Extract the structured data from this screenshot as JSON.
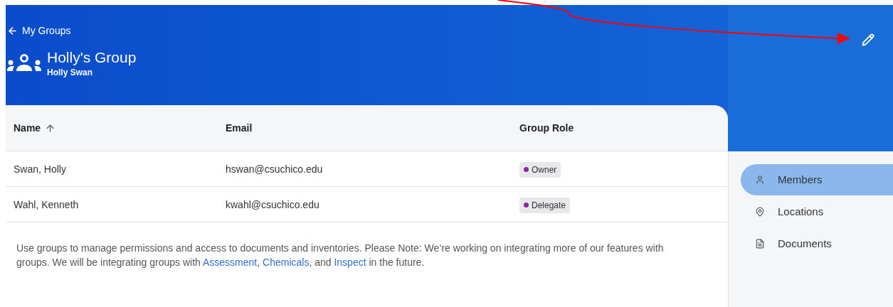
{
  "header": {
    "back_link": "My Groups",
    "title": "Holly's Group",
    "owner": "Holly Swan"
  },
  "table": {
    "columns": [
      {
        "label": "Name",
        "sorted": true
      },
      {
        "label": "Email",
        "sorted": false
      },
      {
        "label": "Group Role",
        "sorted": false
      }
    ],
    "rows": [
      {
        "name": "Swan, Holly",
        "email": "hswan@csuchico.edu",
        "role": "Owner"
      },
      {
        "name": "Wahl, Kenneth",
        "email": "kwahl@csuchico.edu",
        "role": "Delegate"
      }
    ]
  },
  "note": {
    "parts": [
      {
        "kind": "text",
        "text": "Use groups to manage permissions and access to documents and inventories. Please Note: We’re working on integrating more of our features with groups. We will be integrating groups with "
      },
      {
        "kind": "link",
        "text": "Assessment"
      },
      {
        "kind": "text",
        "text": ", "
      },
      {
        "kind": "link",
        "text": "Chemicals"
      },
      {
        "kind": "text",
        "text": ", and "
      },
      {
        "kind": "link",
        "text": "Inspect"
      },
      {
        "kind": "text",
        "text": " in the future."
      }
    ]
  },
  "sidebar": {
    "items": [
      {
        "label": "Members",
        "selected": true
      },
      {
        "label": "Locations",
        "selected": false
      },
      {
        "label": "Documents",
        "selected": false
      }
    ]
  }
}
